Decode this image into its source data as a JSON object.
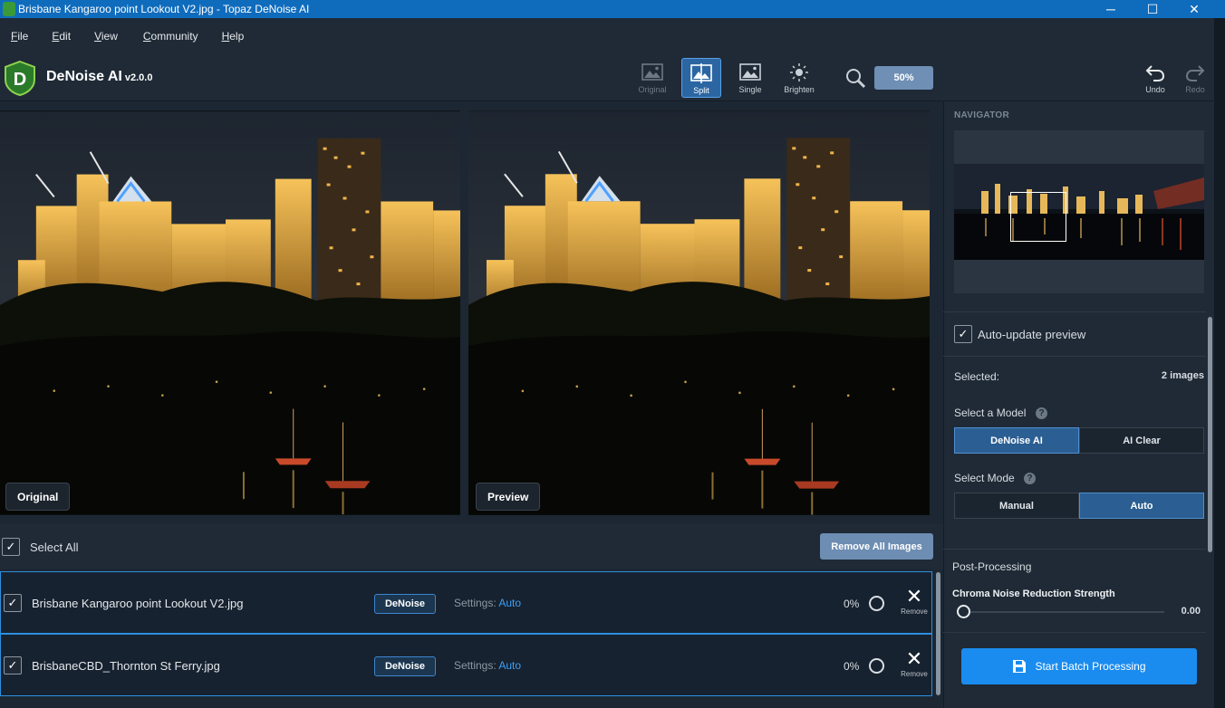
{
  "window": {
    "title": "Brisbane Kangaroo point Lookout V2.jpg - Topaz DeNoise AI",
    "minimize": "─",
    "maximize": "☐",
    "close": "✕"
  },
  "menu": [
    {
      "label": "File",
      "accel": "F",
      "rest": "ile"
    },
    {
      "label": "Edit",
      "accel": "E",
      "rest": "dit"
    },
    {
      "label": "View",
      "accel": "V",
      "rest": "iew"
    },
    {
      "label": "Community",
      "accel": "C",
      "rest": "ommunity"
    },
    {
      "label": "Help",
      "accel": "H",
      "rest": "elp"
    }
  ],
  "toolbar": {
    "app_name": "DeNoise AI",
    "version": "v2.0.0",
    "logo_letter": "D",
    "views": {
      "original": "Original",
      "split": "Split",
      "single": "Single",
      "brighten": "Brighten"
    },
    "zoom": "50%",
    "undo": "Undo",
    "redo": "Redo"
  },
  "preview": {
    "left_label": "Original",
    "right_label": "Preview"
  },
  "panel": {
    "navigator_title": "NAVIGATOR",
    "auto_update": "Auto-update preview",
    "auto_update_checked": true,
    "selected_label": "Selected:",
    "selected_value": "2 images",
    "model_label": "Select a Model",
    "models": [
      "DeNoise AI",
      "AI Clear"
    ],
    "model_active": "DeNoise AI",
    "mode_label": "Select Mode",
    "modes": [
      "Manual",
      "Auto"
    ],
    "mode_active": "Auto",
    "post_processing": "Post-Processing",
    "chroma_label": "Chroma Noise Reduction Strength",
    "chroma_value": "0.00",
    "batch_button": "Start Batch Processing",
    "help": "?"
  },
  "list": {
    "select_all": "Select All",
    "remove_all": "Remove All Images",
    "items": [
      {
        "name": "Brisbane Kangaroo point Lookout V2.jpg",
        "action": "DeNoise",
        "settings_label": "Settings:",
        "settings_value": "Auto",
        "progress": "0%",
        "remove": "Remove"
      },
      {
        "name": "BrisbaneCBD_Thornton St Ferry.jpg",
        "action": "DeNoise",
        "settings_label": "Settings:",
        "settings_value": "Auto",
        "progress": "0%",
        "remove": "Remove"
      }
    ]
  },
  "colors": {
    "accent": "#1a8cef",
    "titlebar": "#0f6cbd",
    "panel": "#1f2a36",
    "selected_segment": "#2b5e92"
  }
}
